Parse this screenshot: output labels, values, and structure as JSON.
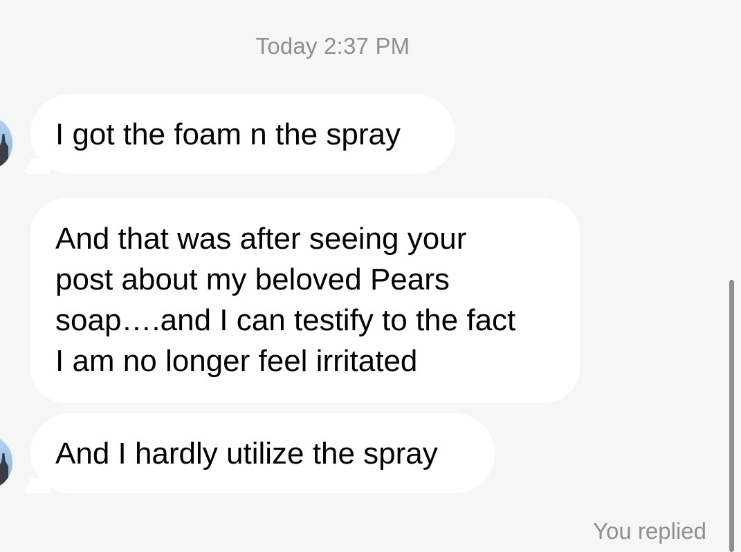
{
  "chat": {
    "timestamp": "Today 2:37 PM",
    "messages": [
      {
        "text": "I got the foam n the spray"
      },
      {
        "lines": [
          "And that was after seeing your",
          "post about my beloved Pears",
          "soap….and I can testify to the fact",
          "I am no longer feel irritated"
        ]
      },
      {
        "text": "And I hardly utilize the spray"
      }
    ],
    "status": "You replied"
  },
  "colors": {
    "background": "#f6f6f6",
    "bubble": "#ffffff",
    "meta_text": "#8e8e93"
  },
  "icons": {
    "avatar": "contact-avatar-icon"
  }
}
